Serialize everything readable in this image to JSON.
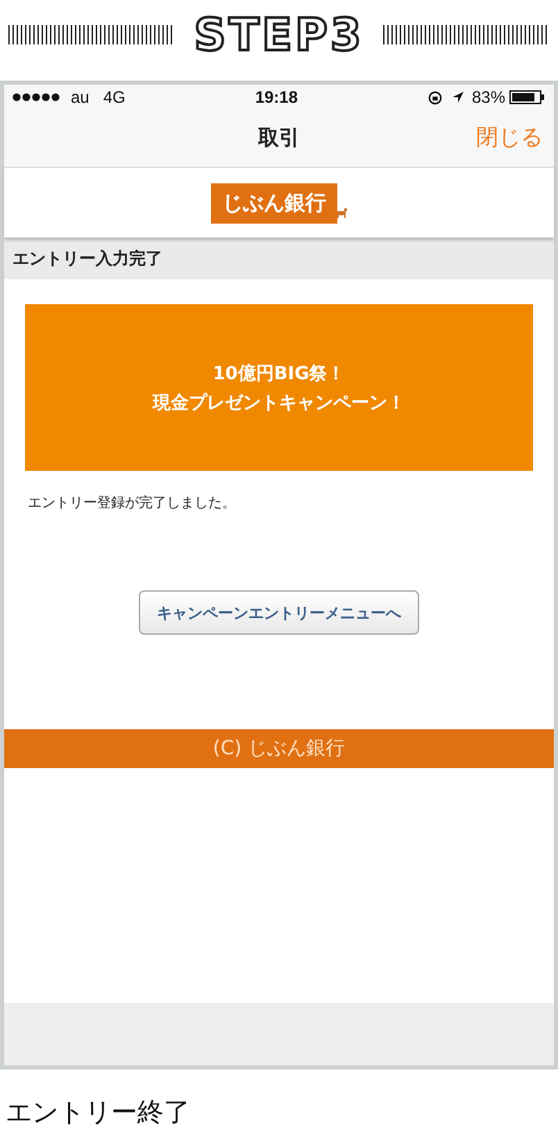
{
  "step_heading": "STEP3",
  "status_bar": {
    "carrier": "au",
    "network": "4G",
    "time": "19:18",
    "battery": "83%"
  },
  "nav_bar": {
    "title": "取引",
    "close": "閉じる"
  },
  "logo": {
    "text": "じぶん銀行"
  },
  "section_header": "エントリー入力完了",
  "banner": {
    "lines": [
      "10億円BIG祭！",
      "現金プレゼントキャンペーン！"
    ]
  },
  "message": "エントリー登録が完了しました。",
  "menu_button": "キャンペーンエントリーメニューへ",
  "footer": "(C) じぶん銀行",
  "caption": "エントリー終了"
}
